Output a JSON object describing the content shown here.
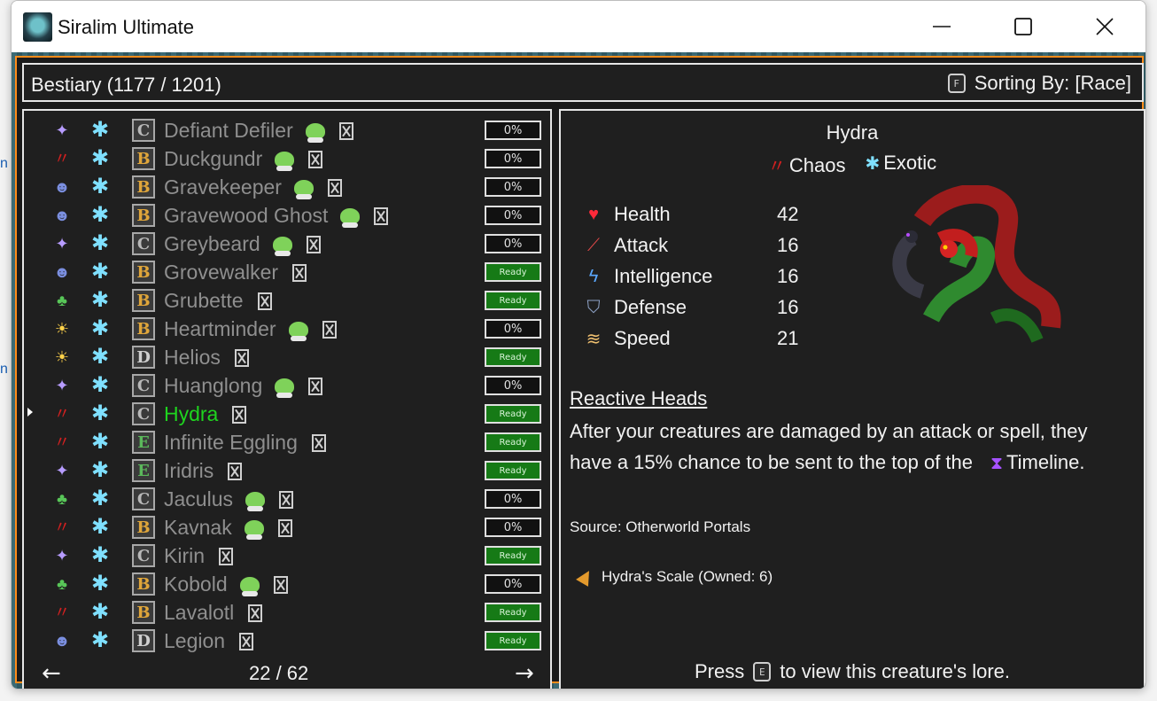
{
  "window": {
    "title": "Siralim Ultimate"
  },
  "header": {
    "title": "Bestiary (1177 / 1201)",
    "sort_key": "F",
    "sort_label": "Sorting By: [Race]"
  },
  "list": {
    "rows": [
      {
        "race_icon": "arcane-icon",
        "class_icon": "exotic-icon",
        "rarity": "C",
        "name": "Defiant Defiler",
        "has_tag": true,
        "status": "0%",
        "ready": false,
        "selected": false
      },
      {
        "race_icon": "chaos-icon",
        "class_icon": "exotic-icon",
        "rarity": "B",
        "name": "Duckgundr",
        "has_tag": true,
        "status": "0%",
        "ready": false,
        "selected": false
      },
      {
        "race_icon": "death-icon",
        "class_icon": "exotic-icon",
        "rarity": "B",
        "name": "Gravekeeper",
        "has_tag": true,
        "status": "0%",
        "ready": false,
        "selected": false
      },
      {
        "race_icon": "death-icon",
        "class_icon": "exotic-icon",
        "rarity": "B",
        "name": "Gravewood Ghost",
        "has_tag": true,
        "status": "0%",
        "ready": false,
        "selected": false
      },
      {
        "race_icon": "arcane-icon",
        "class_icon": "exotic-icon",
        "rarity": "C",
        "name": "Greybeard",
        "has_tag": true,
        "status": "0%",
        "ready": false,
        "selected": false
      },
      {
        "race_icon": "death-icon",
        "class_icon": "exotic-icon",
        "rarity": "B",
        "name": "Grovewalker",
        "has_tag": false,
        "status": "Ready",
        "ready": true,
        "selected": false
      },
      {
        "race_icon": "nature-icon",
        "class_icon": "exotic-icon",
        "rarity": "B",
        "name": "Grubette",
        "has_tag": false,
        "status": "Ready",
        "ready": true,
        "selected": false
      },
      {
        "race_icon": "life-icon",
        "class_icon": "exotic-icon",
        "rarity": "B",
        "name": "Heartminder",
        "has_tag": true,
        "status": "0%",
        "ready": false,
        "selected": false
      },
      {
        "race_icon": "life-icon",
        "class_icon": "exotic-icon",
        "rarity": "D",
        "name": "Helios",
        "has_tag": false,
        "status": "Ready",
        "ready": true,
        "selected": false
      },
      {
        "race_icon": "arcane-icon",
        "class_icon": "exotic-icon",
        "rarity": "C",
        "name": "Huanglong",
        "has_tag": true,
        "status": "0%",
        "ready": false,
        "selected": false
      },
      {
        "race_icon": "chaos-icon",
        "class_icon": "exotic-icon",
        "rarity": "C",
        "name": "Hydra",
        "has_tag": false,
        "status": "Ready",
        "ready": true,
        "selected": true
      },
      {
        "race_icon": "chaos-icon",
        "class_icon": "exotic-icon",
        "rarity": "E",
        "name": "Infinite Eggling",
        "has_tag": false,
        "status": "Ready",
        "ready": true,
        "selected": false
      },
      {
        "race_icon": "arcane-icon",
        "class_icon": "exotic-icon",
        "rarity": "E",
        "name": "Iridris",
        "has_tag": false,
        "status": "Ready",
        "ready": true,
        "selected": false
      },
      {
        "race_icon": "nature-icon",
        "class_icon": "exotic-icon",
        "rarity": "C",
        "name": "Jaculus",
        "has_tag": true,
        "status": "0%",
        "ready": false,
        "selected": false
      },
      {
        "race_icon": "chaos-icon",
        "class_icon": "exotic-icon",
        "rarity": "B",
        "name": "Kavnak",
        "has_tag": true,
        "status": "0%",
        "ready": false,
        "selected": false
      },
      {
        "race_icon": "arcane-icon",
        "class_icon": "exotic-icon",
        "rarity": "C",
        "name": "Kirin",
        "has_tag": false,
        "status": "Ready",
        "ready": true,
        "selected": false
      },
      {
        "race_icon": "nature-icon",
        "class_icon": "exotic-icon",
        "rarity": "B",
        "name": "Kobold",
        "has_tag": true,
        "status": "0%",
        "ready": false,
        "selected": false
      },
      {
        "race_icon": "chaos-icon",
        "class_icon": "exotic-icon",
        "rarity": "B",
        "name": "Lavalotl",
        "has_tag": false,
        "status": "Ready",
        "ready": true,
        "selected": false
      },
      {
        "race_icon": "death-icon",
        "class_icon": "exotic-icon",
        "rarity": "D",
        "name": "Legion",
        "has_tag": false,
        "status": "Ready",
        "ready": true,
        "selected": false
      }
    ],
    "prev_arrow": "←",
    "next_arrow": "→",
    "page": "22 / 62"
  },
  "detail": {
    "name": "Hydra",
    "types": [
      {
        "icon": "chaos-icon",
        "label": "Chaos"
      },
      {
        "icon": "exotic-icon",
        "label": "Exotic"
      }
    ],
    "stats": [
      {
        "icon": "heart-icon",
        "label": "Health",
        "value": "42"
      },
      {
        "icon": "sword-icon",
        "label": "Attack",
        "value": "16"
      },
      {
        "icon": "lightning-icon",
        "label": "Intelligence",
        "value": "16"
      },
      {
        "icon": "shield-icon",
        "label": "Defense",
        "value": "16"
      },
      {
        "icon": "wing-icon",
        "label": "Speed",
        "value": "21"
      }
    ],
    "trait_title": "Reactive Heads",
    "trait_text_1": "After your creatures are damaged by an attack or spell, they",
    "trait_text_2a": "have a 15% chance to be sent to the top of the",
    "trait_text_2b": "Timeline.",
    "source": "Source: Otherworld Portals",
    "material": "Hydra's Scale (Owned: 6)",
    "lore_pre": "Press",
    "lore_key": "E",
    "lore_post": "to view this creature's lore."
  },
  "colors": {
    "frame_accent": "#ff8c1a",
    "ready_green": "#167a16",
    "selected_name": "#1fd41f"
  }
}
